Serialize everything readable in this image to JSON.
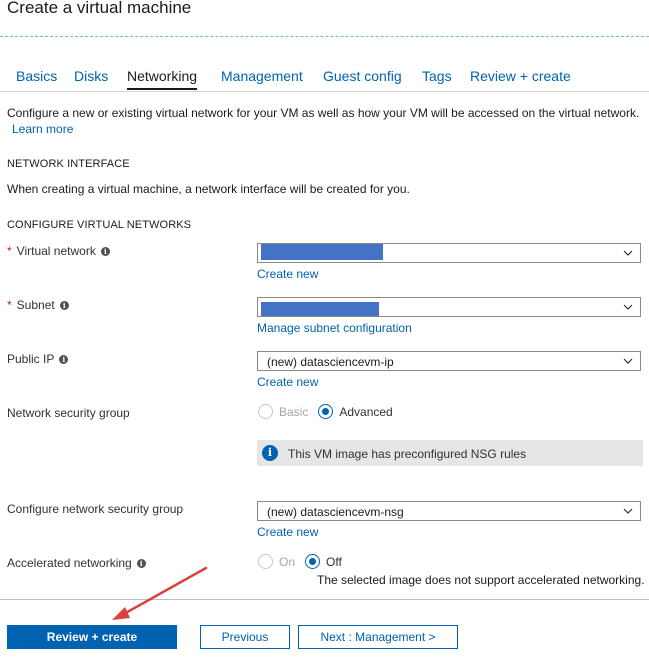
{
  "page": {
    "title": "Create a virtual machine"
  },
  "tabs": [
    {
      "label": "Basics"
    },
    {
      "label": "Disks"
    },
    {
      "label": "Networking"
    },
    {
      "label": "Management"
    },
    {
      "label": "Guest config"
    },
    {
      "label": "Tags"
    },
    {
      "label": "Review + create"
    }
  ],
  "intro": {
    "text": "Configure a new or existing virtual network for your VM as well as how your VM will be accessed on the virtual network.",
    "learn_more": "Learn more"
  },
  "network_interface": {
    "heading": "NETWORK INTERFACE",
    "description": "When creating a virtual machine, a network interface will be created for you."
  },
  "configure_vnets": {
    "heading": "CONFIGURE VIRTUAL NETWORKS"
  },
  "fields": {
    "virtual_network": {
      "label": "Virtual network",
      "required_mark": "*",
      "value": "",
      "link": "Create new"
    },
    "subnet": {
      "label": "Subnet",
      "required_mark": "*",
      "value": "",
      "link": "Manage subnet configuration"
    },
    "public_ip": {
      "label": "Public IP",
      "value": "(new) datasciencevm-ip",
      "link": "Create new"
    },
    "nsg": {
      "label": "Network security group",
      "options": [
        "Basic",
        "Advanced"
      ],
      "selected": "Advanced",
      "info_message": "This VM image has preconfigured NSG rules"
    },
    "configure_nsg": {
      "label": "Configure network security group",
      "value": "(new) datasciencevm-nsg",
      "link": "Create new"
    },
    "accelerated_networking": {
      "label": "Accelerated networking",
      "options": [
        "On",
        "Off"
      ],
      "selected": "Off",
      "note": "The selected image does not support accelerated networking."
    }
  },
  "footer": {
    "review_create": "Review + create",
    "previous": "Previous",
    "next": "Next : Management >"
  },
  "colors": {
    "accent": "#0063b1",
    "required": "#a4262c",
    "redaction": "#4472c4",
    "annotation_arrow": "#d9433e"
  },
  "icons": {
    "info": "info-icon",
    "chevron": "chevron-down-icon",
    "arrow": "annotation-arrow"
  }
}
